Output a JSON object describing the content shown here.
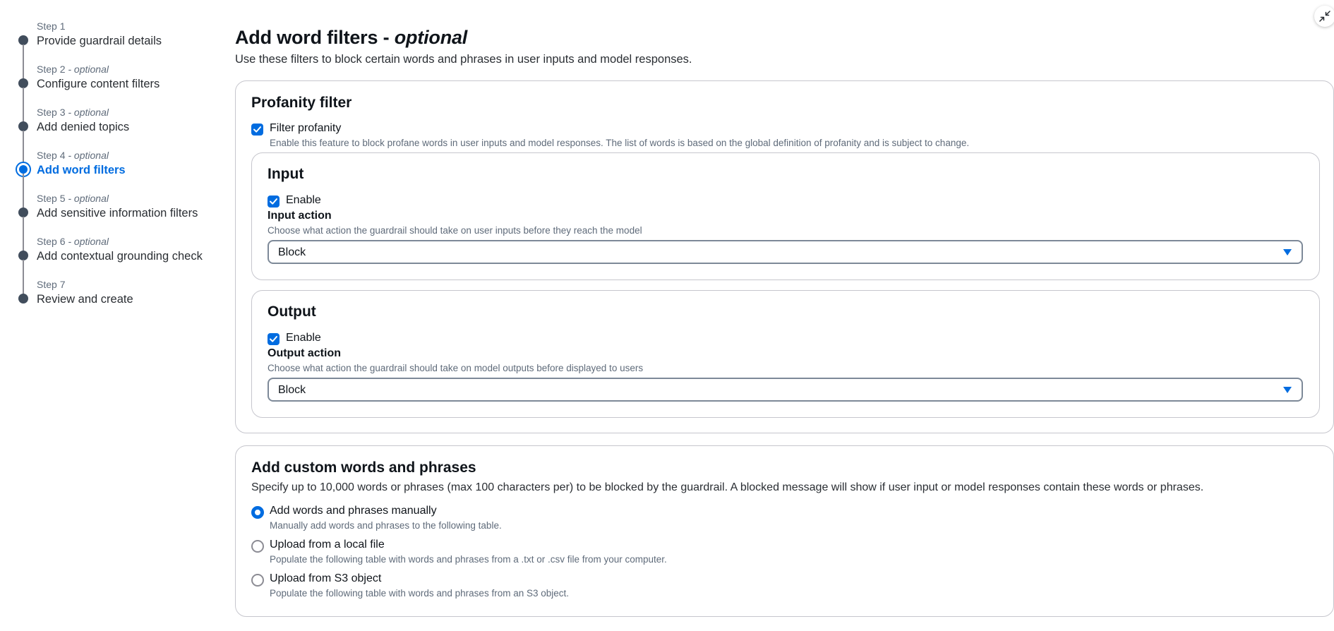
{
  "wizard": {
    "steps": [
      {
        "label": "Step 1",
        "optional": "",
        "title": "Provide guardrail details",
        "active": false
      },
      {
        "label": "Step 2",
        "optional": "- optional",
        "title": "Configure content filters",
        "active": false
      },
      {
        "label": "Step 3",
        "optional": "- optional",
        "title": "Add denied topics",
        "active": false
      },
      {
        "label": "Step 4",
        "optional": "- optional",
        "title": "Add word filters",
        "active": true
      },
      {
        "label": "Step 5",
        "optional": "- optional",
        "title": "Add sensitive information filters",
        "active": false
      },
      {
        "label": "Step 6",
        "optional": "- optional",
        "title": "Add contextual grounding check",
        "active": false
      },
      {
        "label": "Step 7",
        "optional": "",
        "title": "Review and create",
        "active": false
      }
    ]
  },
  "page": {
    "title": "Add word filters -",
    "title_optional": "optional",
    "description": "Use these filters to block certain words and phrases in user inputs and model responses."
  },
  "profanity": {
    "title": "Profanity filter",
    "checkbox_label": "Filter profanity",
    "checkbox_checked": true,
    "checkbox_desc": "Enable this feature to block profane words in user inputs and model responses. The list of words is based on the global definition of profanity and is subject to change.",
    "input": {
      "title": "Input",
      "enable_label": "Enable",
      "action_label": "Input action",
      "action_desc": "Choose what action the guardrail should take on user inputs before they reach the model",
      "action_value": "Block"
    },
    "output": {
      "title": "Output",
      "enable_label": "Enable",
      "action_label": "Output action",
      "action_desc": "Choose what action the guardrail should take on model outputs before displayed to users",
      "action_value": "Block"
    }
  },
  "custom": {
    "title": "Add custom words and phrases",
    "description": "Specify up to 10,000 words or phrases (max 100 characters per) to be blocked by the guardrail. A blocked message will show if user input or model responses contain these words or phrases.",
    "options": [
      {
        "label": "Add words and phrases manually",
        "desc": "Manually add words and phrases to the following table.",
        "checked": true
      },
      {
        "label": "Upload from a local file",
        "desc": "Populate the following table with words and phrases from a .txt or .csv file from your computer.",
        "checked": false
      },
      {
        "label": "Upload from S3 object",
        "desc": "Populate the following table with words and phrases from an S3 object.",
        "checked": false
      }
    ]
  },
  "colors": {
    "accent": "#006ce0",
    "step_dot": "#414d5c",
    "border": "#c6c6cd"
  },
  "icons": {
    "collapse": "collapse-arrows-icon",
    "checkbox": "check-icon",
    "dropdown": "caret-down-icon"
  }
}
